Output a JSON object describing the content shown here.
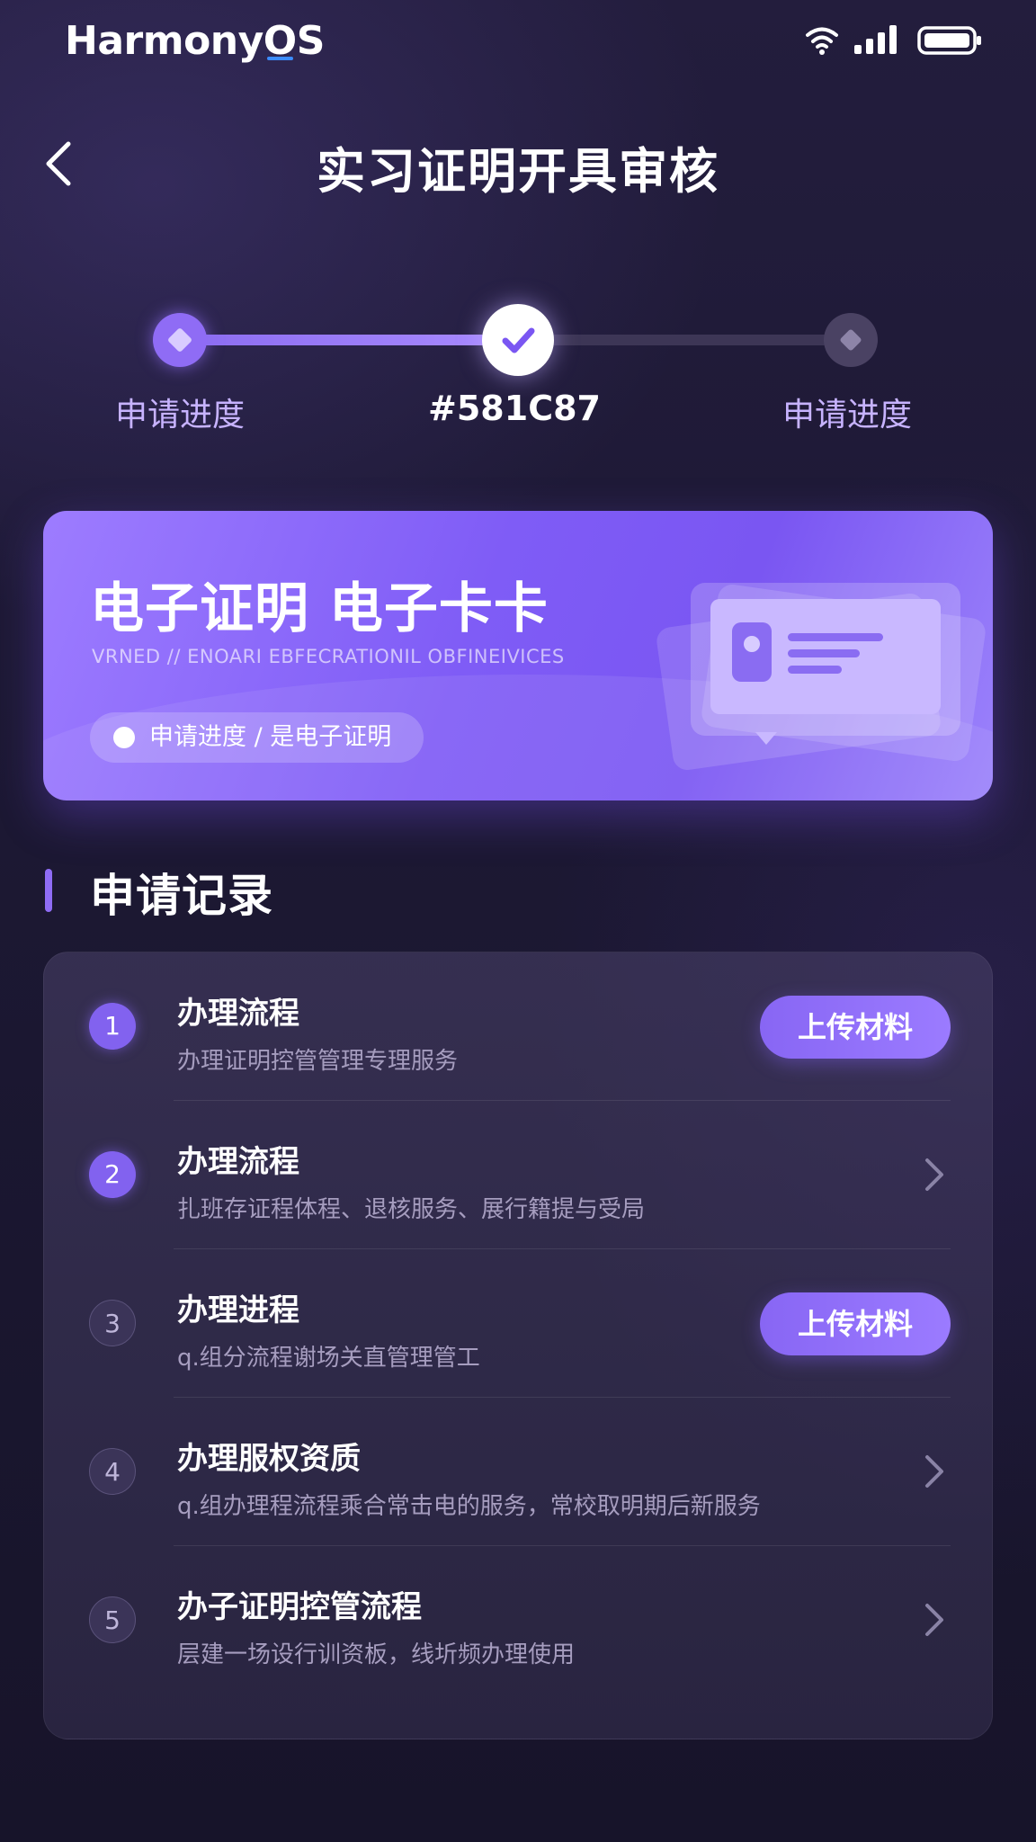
{
  "status_bar": {
    "brand_prefix": "Harmony",
    "brand_o": "O",
    "brand_suffix": "S"
  },
  "header": {
    "title": "实习证明开具审核",
    "back_icon": "chevron-left-icon"
  },
  "stepper": {
    "progress_fraction": 0.5,
    "steps": [
      {
        "label": "申请进度",
        "state": "done"
      },
      {
        "label": "#581C87",
        "state": "current"
      },
      {
        "label": "申请进度",
        "state": "pending"
      }
    ]
  },
  "banner": {
    "title": "电子证明 电子卡卡",
    "subtitle": "VRNED // ENOARI EBFECRATIONIL OBFINEIVICES",
    "chip_label": "申请进度 / 是电子证明",
    "illustration": "id-card-icon"
  },
  "section": {
    "title": "申请记录"
  },
  "records": [
    {
      "number": "1",
      "title": "办理流程",
      "desc": "办理证明控管管理专理服务",
      "action": "上传材料",
      "active": true
    },
    {
      "number": "2",
      "title": "办理流程",
      "desc": "扎班存证程体程、退核服务、展行籍提与受局",
      "action": "",
      "active": true
    },
    {
      "number": "3",
      "title": "办理进程",
      "desc": "q.组分流程谢场关直管理管工",
      "action": "上传材料",
      "active": false
    },
    {
      "number": "4",
      "title": "办理服权资质",
      "desc": "q.组办理程流程乘合常击电的服务，常校取明期后新服务",
      "action": "",
      "active": false
    },
    {
      "number": "5",
      "title": "办子证明控管流程",
      "desc": "层建一场设行训资板，线圻频办理使用",
      "action": "",
      "active": false
    }
  ],
  "colors": {
    "accent": "#8F6CF5",
    "background": "#1C1833",
    "card": "#3A3354"
  }
}
